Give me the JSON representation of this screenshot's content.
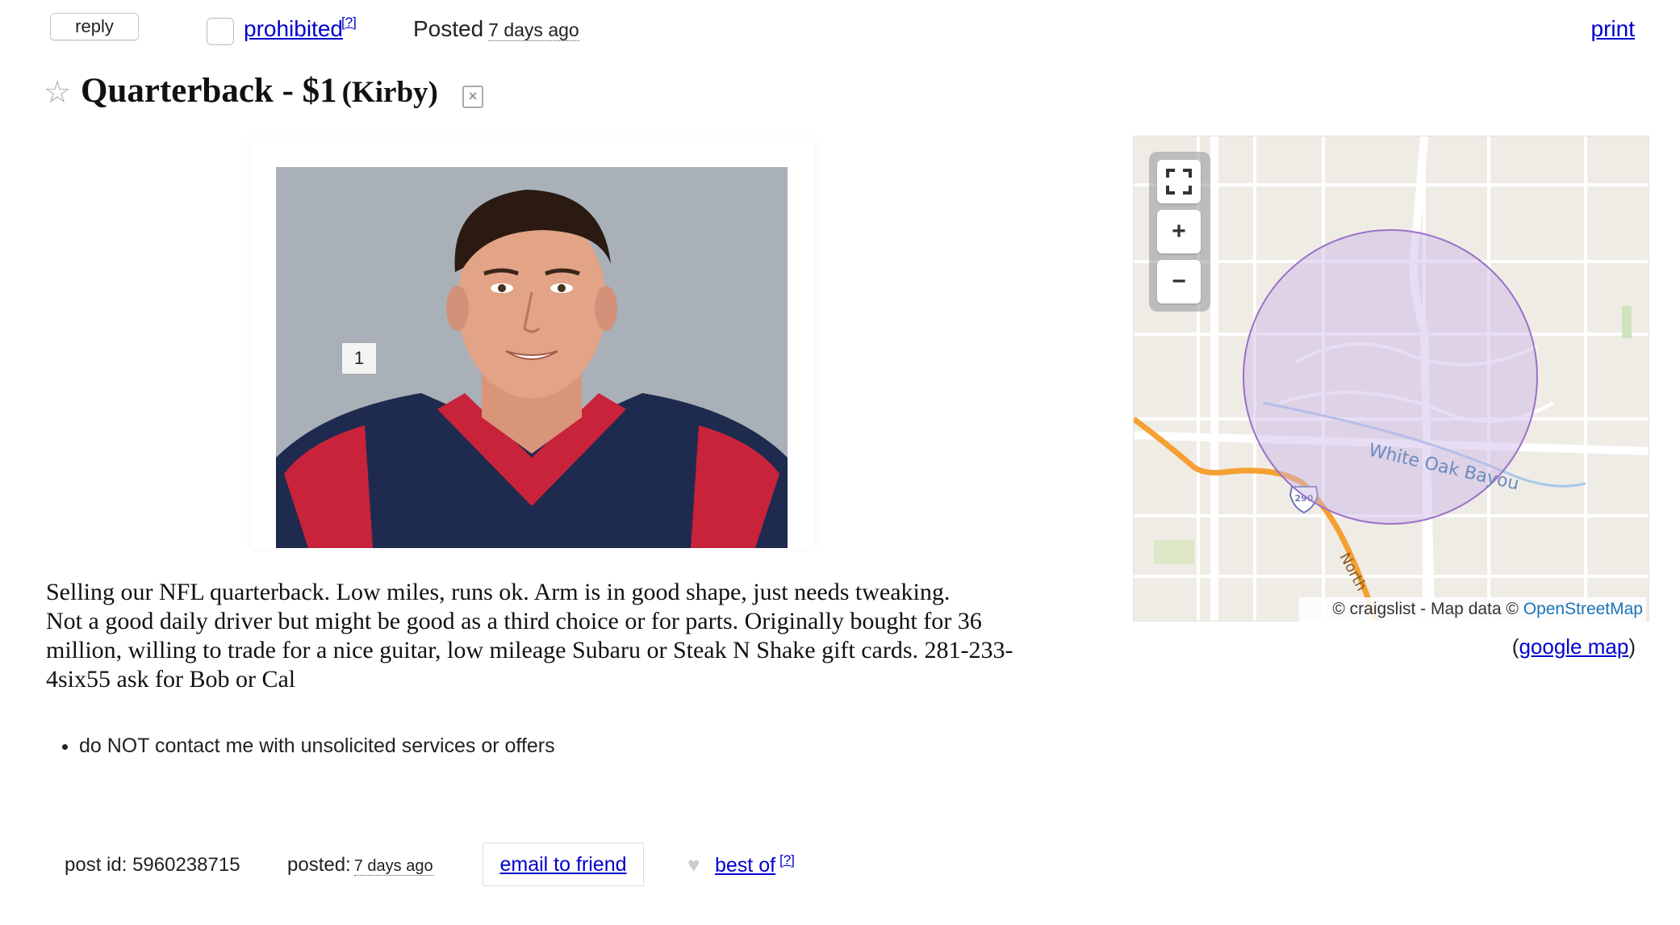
{
  "topbar": {
    "reply_label": "reply",
    "prohibited_label": "prohibited",
    "help_mark": "[?]",
    "posted_label": "Posted",
    "posted_ago": "7 days ago",
    "print_label": "print"
  },
  "title": {
    "heading": "Quarterback - $1",
    "location": "(Kirby)"
  },
  "image": {
    "badge_number": "1"
  },
  "body": {
    "lines": [
      "Selling our NFL quarterback. Low miles, runs ok. Arm is in good shape, just needs tweaking.",
      "Not a good daily driver but might be good as a third choice or for parts. Originally bought for 36",
      "million, willing to trade for a nice guitar, low mileage Subaru or Steak N Shake gift cards. 281-233-",
      "4six55 ask for Bob or Cal"
    ]
  },
  "notices": {
    "items": [
      "do NOT contact me with unsolicited services or offers"
    ]
  },
  "map": {
    "water_label": "White Oak Bayou",
    "highway_label": "290",
    "road_label": "North",
    "attribution_prefix": "© craigslist - Map data ©",
    "attribution_link": "OpenStreetMap",
    "google_map_open": "(",
    "google_map_label": "google map",
    "google_map_close": ")",
    "colors": {
      "circle_fill": "#c9b3e6",
      "circle_stroke": "#9b6fc8",
      "highway": "#f5a033"
    }
  },
  "footer": {
    "post_id_label": "post id:",
    "post_id_value": "5960238715",
    "posted_label": "posted:",
    "posted_ago": "7 days ago",
    "email_label": "email to friend",
    "bestof_label": "best of",
    "help_mark": "[?]"
  },
  "icons": {
    "star": "star-icon",
    "hide": "hide-icon",
    "heart": "heart-icon",
    "fullscreen": "fullscreen-icon",
    "zoom_in": "zoom-in-icon",
    "zoom_out": "zoom-out-icon"
  }
}
